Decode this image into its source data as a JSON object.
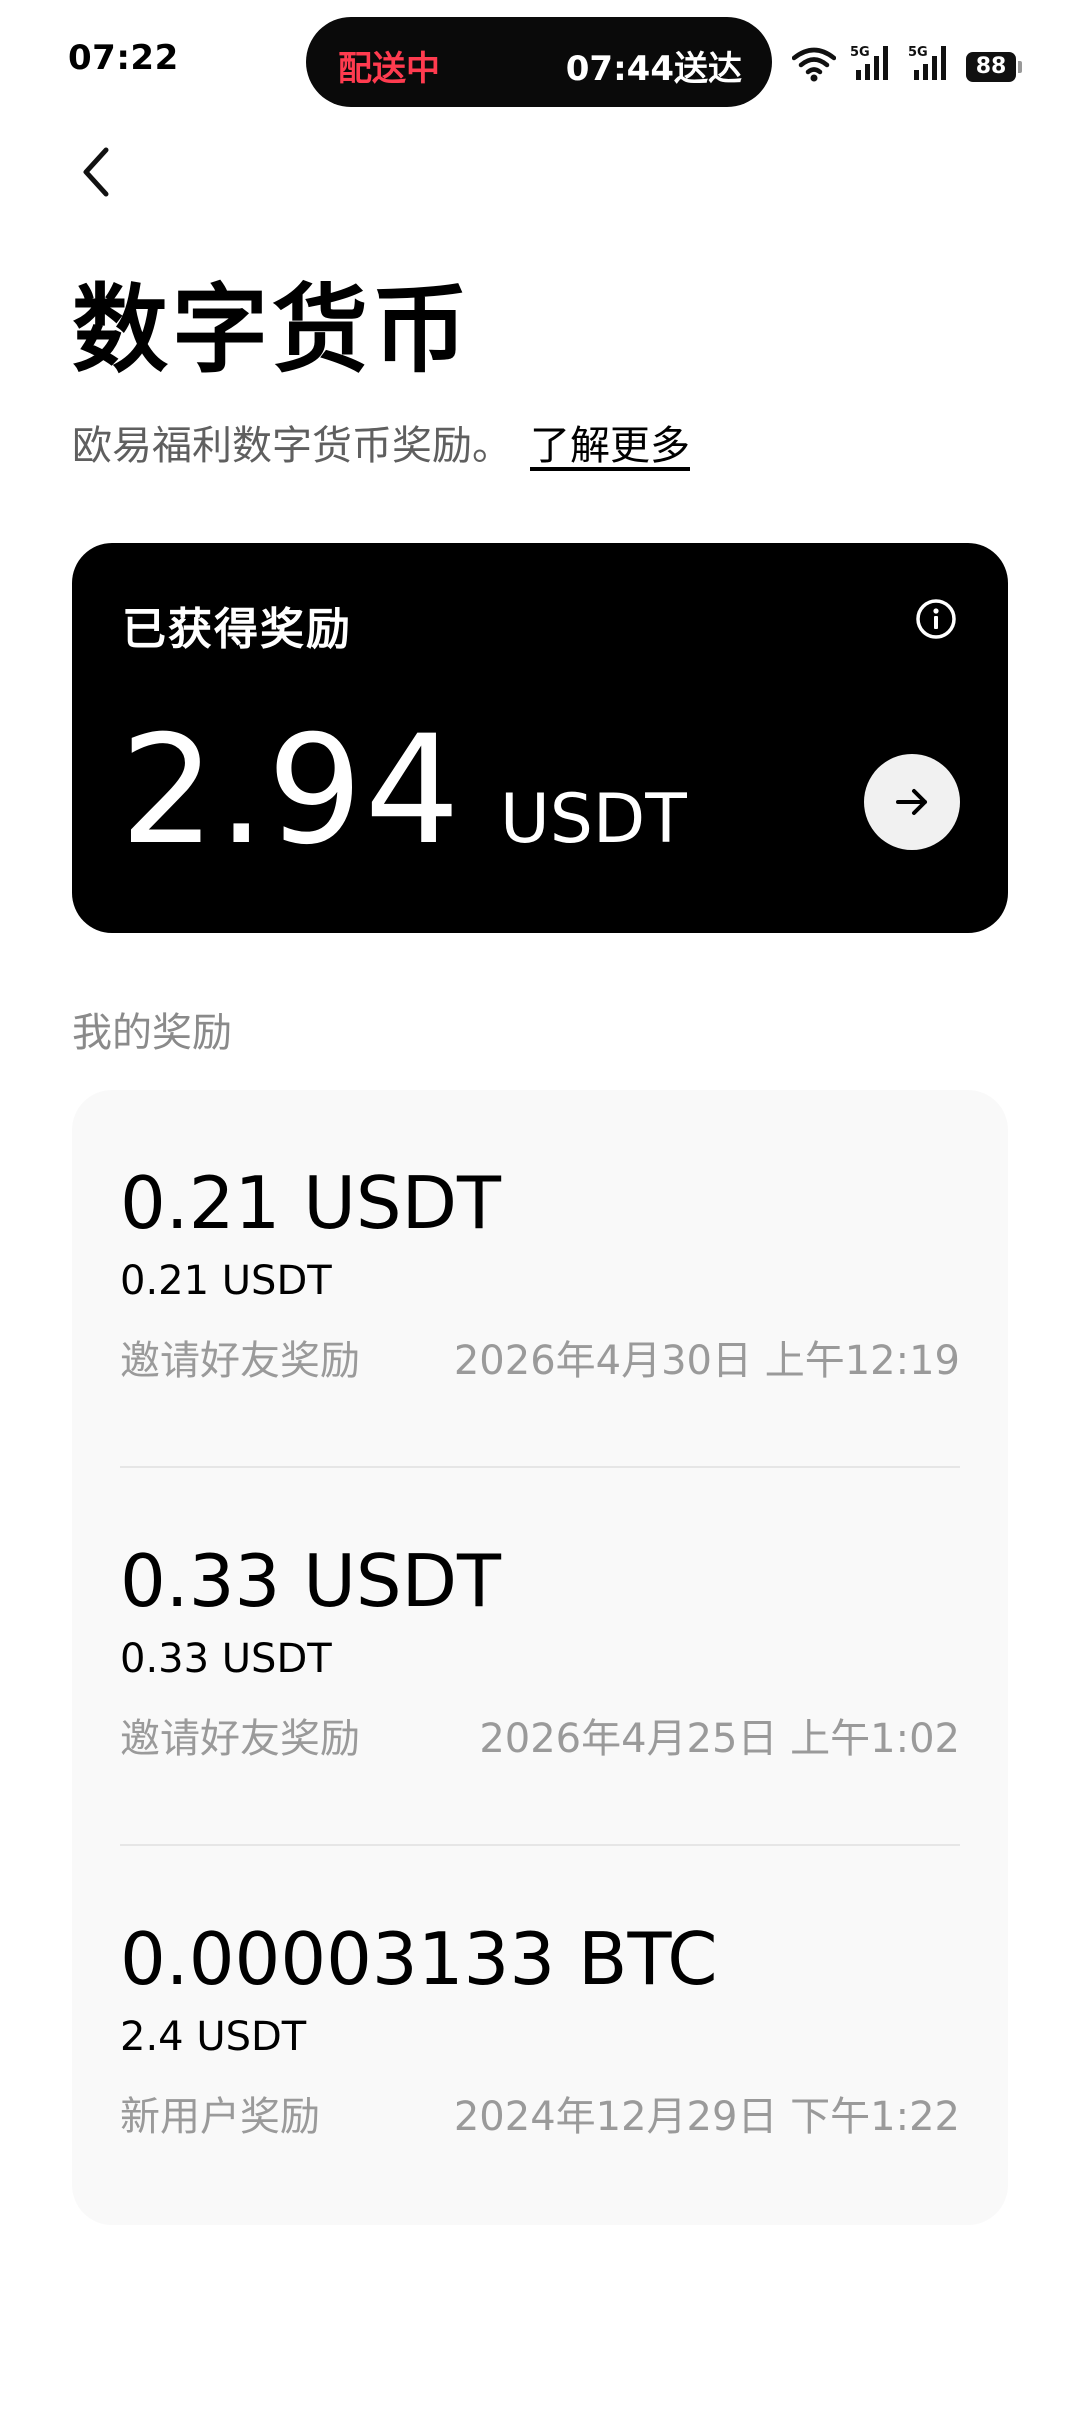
{
  "status_bar": {
    "time": "07:22",
    "island_status": "配送中",
    "island_eta": "07:44送达",
    "network_1": "5G",
    "network_2": "5G",
    "battery": "88"
  },
  "header": {
    "title": "数字货币",
    "subtitle": "欧易福利数字货币奖励。",
    "learn_more": "了解更多"
  },
  "summary": {
    "label": "已获得奖励",
    "amount": "2.94",
    "unit": "USDT"
  },
  "rewards_section": {
    "title": "我的奖励",
    "items": [
      {
        "primary": "0.21 USDT",
        "secondary": "0.21 USDT",
        "type": "邀请好友奖励",
        "date": "2026年4月30日 上午12:19"
      },
      {
        "primary": "0.33 USDT",
        "secondary": "0.33 USDT",
        "type": "邀请好友奖励",
        "date": "2026年4月25日 上午1:02"
      },
      {
        "primary": "0.00003133 BTC",
        "secondary": "2.4 USDT",
        "type": "新用户奖励",
        "date": "2024年12月29日 下午1:22"
      }
    ]
  },
  "colors": {
    "accent_red": "#ff3b4f",
    "card_bg": "#000000",
    "list_bg": "#f9f9f9"
  },
  "icons": [
    "back-arrow-icon",
    "info-icon",
    "arrow-right-icon",
    "wifi-icon",
    "signal-icon",
    "battery-icon"
  ]
}
